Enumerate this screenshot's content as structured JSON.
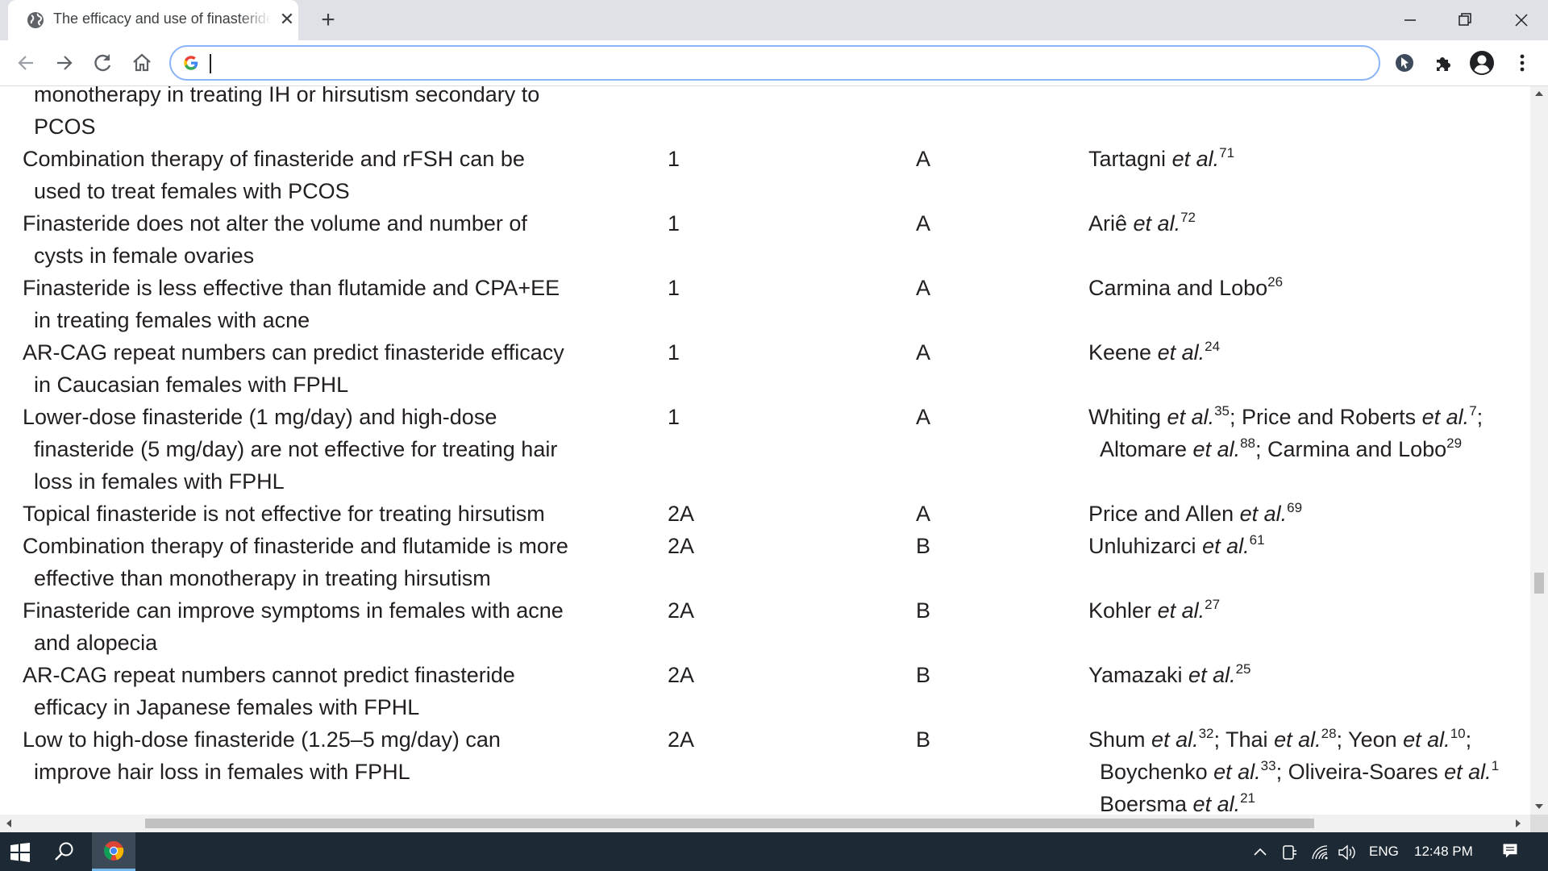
{
  "browser": {
    "tab_title": "The efficacy and use of finasteride in women",
    "tab_close": "✕",
    "new_tab": "+",
    "address_value": "",
    "address_placeholder": ""
  },
  "table": {
    "rows": [
      {
        "lines": [
          {
            "runs": [
              {
                "t": "monotherapy in treating IH or hirsutism secondary to"
              }
            ]
          },
          {
            "runs": [
              {
                "t": "PCOS"
              }
            ]
          }
        ],
        "level": "",
        "grade": "",
        "refs": []
      },
      {
        "lines": [
          {
            "runs": [
              {
                "t": "Combination therapy of finasteride and rFSH can be"
              }
            ]
          },
          {
            "runs": [
              {
                "t": "used to treat females with PCOS"
              }
            ]
          }
        ],
        "level": "1",
        "grade": "A",
        "refs": [
          {
            "runs": [
              {
                "t": "Tartagni "
              },
              {
                "t": "et al.",
                "i": true
              },
              {
                "t": "71",
                "sup": true
              }
            ]
          }
        ]
      },
      {
        "lines": [
          {
            "runs": [
              {
                "t": "Finasteride does not alter the volume and number of"
              }
            ]
          },
          {
            "runs": [
              {
                "t": "cysts in female ovaries"
              }
            ]
          }
        ],
        "level": "1",
        "grade": "A",
        "refs": [
          {
            "runs": [
              {
                "t": "Ariê "
              },
              {
                "t": "et al.",
                "i": true
              },
              {
                "t": "72",
                "sup": true
              }
            ]
          }
        ]
      },
      {
        "lines": [
          {
            "runs": [
              {
                "t": "Finasteride is less effective than flutamide and CPA+EE"
              }
            ]
          },
          {
            "runs": [
              {
                "t": "in treating females with acne"
              }
            ]
          }
        ],
        "level": "1",
        "grade": "A",
        "refs": [
          {
            "runs": [
              {
                "t": "Carmina and Lobo"
              },
              {
                "t": "26",
                "sup": true
              }
            ]
          }
        ]
      },
      {
        "lines": [
          {
            "runs": [
              {
                "t": "AR-CAG repeat numbers can predict finasteride efficacy"
              }
            ]
          },
          {
            "runs": [
              {
                "t": "in Caucasian females with FPHL"
              }
            ]
          }
        ],
        "level": "1",
        "grade": "A",
        "refs": [
          {
            "runs": [
              {
                "t": "Keene "
              },
              {
                "t": "et al.",
                "i": true
              },
              {
                "t": "24",
                "sup": true
              }
            ]
          }
        ]
      },
      {
        "lines": [
          {
            "runs": [
              {
                "t": "Lower-dose finasteride (1 mg/day) and high-dose"
              }
            ]
          },
          {
            "runs": [
              {
                "t": "finasteride (5 mg/day) are not effective for treating hair"
              }
            ]
          },
          {
            "runs": [
              {
                "t": "loss in females with FPHL"
              }
            ]
          }
        ],
        "level": "1",
        "grade": "A",
        "refs": [
          {
            "runs": [
              {
                "t": "Whiting "
              },
              {
                "t": "et al.",
                "i": true
              },
              {
                "t": "35",
                "sup": true
              },
              {
                "t": "; Price and Roberts "
              },
              {
                "t": "et al.",
                "i": true
              },
              {
                "t": "7",
                "sup": true
              },
              {
                "t": ";"
              }
            ]
          },
          {
            "runs": [
              {
                "t": "Altomare "
              },
              {
                "t": "et al.",
                "i": true
              },
              {
                "t": "88",
                "sup": true
              },
              {
                "t": "; Carmina and Lobo"
              },
              {
                "t": "29",
                "sup": true
              }
            ]
          }
        ]
      },
      {
        "lines": [
          {
            "runs": [
              {
                "t": "Topical finasteride is not effective for treating hirsutism"
              }
            ]
          }
        ],
        "level": "2A",
        "grade": "A",
        "refs": [
          {
            "runs": [
              {
                "t": "Price and Allen "
              },
              {
                "t": "et al.",
                "i": true
              },
              {
                "t": "69",
                "sup": true
              }
            ]
          }
        ]
      },
      {
        "lines": [
          {
            "runs": [
              {
                "t": "Combination therapy of finasteride and flutamide is more"
              }
            ]
          },
          {
            "runs": [
              {
                "t": "effective than monotherapy in treating hirsutism"
              }
            ]
          }
        ],
        "level": "2A",
        "grade": "B",
        "refs": [
          {
            "runs": [
              {
                "t": "Unluhizarci "
              },
              {
                "t": "et al.",
                "i": true
              },
              {
                "t": "61",
                "sup": true
              }
            ]
          }
        ]
      },
      {
        "lines": [
          {
            "runs": [
              {
                "t": "Finasteride can improve symptoms in females with acne"
              }
            ]
          },
          {
            "runs": [
              {
                "t": "and alopecia"
              }
            ]
          }
        ],
        "level": "2A",
        "grade": "B",
        "refs": [
          {
            "runs": [
              {
                "t": "Kohler "
              },
              {
                "t": "et al.",
                "i": true
              },
              {
                "t": "27",
                "sup": true
              }
            ]
          }
        ]
      },
      {
        "lines": [
          {
            "runs": [
              {
                "t": "AR-CAG repeat numbers cannot predict finasteride"
              }
            ]
          },
          {
            "runs": [
              {
                "t": "efficacy in Japanese females with FPHL"
              }
            ]
          }
        ],
        "level": "2A",
        "grade": "B",
        "refs": [
          {
            "runs": [
              {
                "t": "Yamazaki "
              },
              {
                "t": "et al.",
                "i": true
              },
              {
                "t": "25",
                "sup": true
              }
            ]
          }
        ]
      },
      {
        "lines": [
          {
            "runs": [
              {
                "t": "Low to high-dose finasteride (1.25–5 mg/day) can"
              }
            ]
          },
          {
            "runs": [
              {
                "t": "improve hair loss in females with FPHL"
              }
            ]
          }
        ],
        "level": "2A",
        "grade": "B",
        "refs": [
          {
            "runs": [
              {
                "t": "Shum "
              },
              {
                "t": "et al.",
                "i": true
              },
              {
                "t": "32",
                "sup": true
              },
              {
                "t": "; Thai "
              },
              {
                "t": "et al.",
                "i": true
              },
              {
                "t": "28",
                "sup": true
              },
              {
                "t": "; Yeon "
              },
              {
                "t": "et al.",
                "i": true
              },
              {
                "t": "10",
                "sup": true
              },
              {
                "t": ";"
              }
            ]
          },
          {
            "runs": [
              {
                "t": "Boychenko "
              },
              {
                "t": "et al.",
                "i": true
              },
              {
                "t": "33",
                "sup": true
              },
              {
                "t": "; Oliveira-Soares "
              },
              {
                "t": "et al.",
                "i": true
              },
              {
                "t": "1",
                "sup": true
              }
            ]
          },
          {
            "runs": [
              {
                "t": "Boersma "
              },
              {
                "t": "et al.",
                "i": true
              },
              {
                "t": "21",
                "sup": true
              }
            ]
          }
        ]
      }
    ]
  },
  "taskbar": {
    "language": "ENG",
    "time": "12:48 PM"
  }
}
